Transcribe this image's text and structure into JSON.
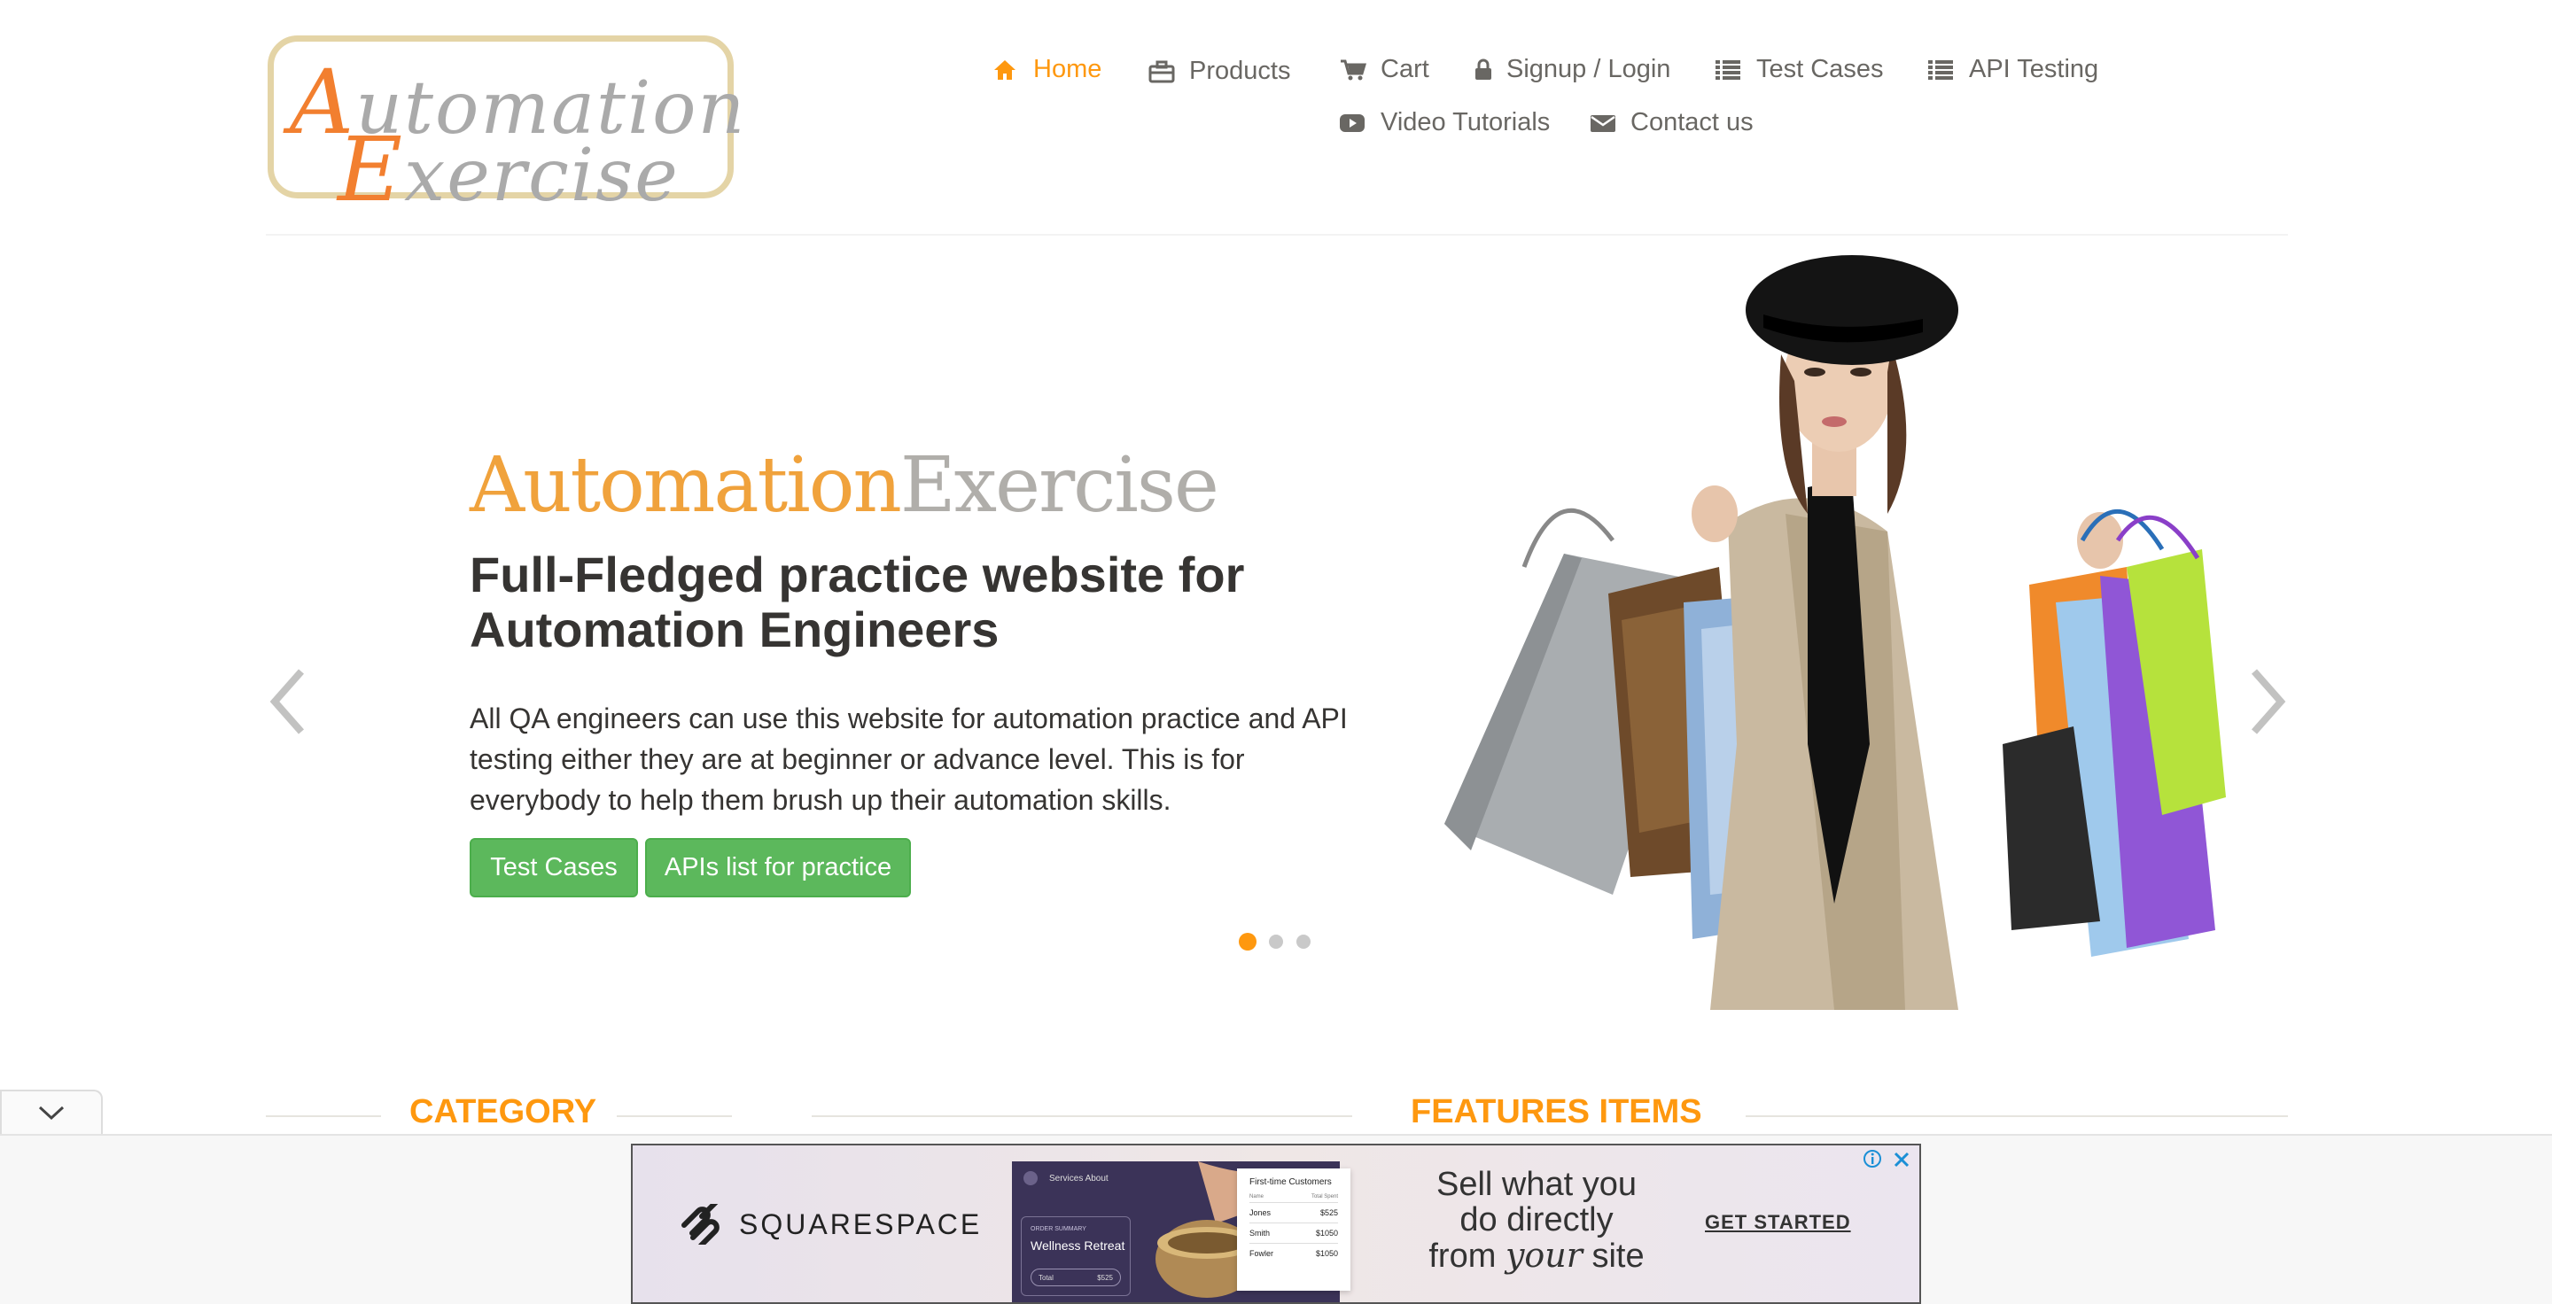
{
  "logo": {
    "line1_cap": "A",
    "line1_rest": "utomation",
    "line2_cap": "E",
    "line2_rest": "xercise"
  },
  "nav": {
    "home": "Home",
    "products": "Products",
    "cart": "Cart",
    "signup": "Signup / Login",
    "test_cases": "Test Cases",
    "api_testing": "API Testing",
    "video_tutorials": "Video Tutorials",
    "contact": "Contact us",
    "active_color": "#fe980f"
  },
  "slider": {
    "title_a": "Automation",
    "title_b": "Exercise",
    "heading": "Full-Fledged practice website for Automation Engineers",
    "text": "All QA engineers can use this website for automation practice and API testing either they are at beginner or advance level. This is for everybody to help them brush up their automation skills.",
    "btn_test_cases": "Test Cases",
    "btn_apis": "APIs list for practice",
    "active_slide": 1,
    "slide_count": 3
  },
  "sections": {
    "category": "CATEGORY",
    "features": "FEATURES ITEMS"
  },
  "ad": {
    "brand": "SQUARESPACE",
    "mock_nav": "Services   About",
    "mock_kicker": "ORDER SUMMARY",
    "mock_title": "Wellness Retreat",
    "mock_total_label": "Total",
    "mock_total": "$525",
    "table_title": "First-time Customers",
    "table_col1": "Name",
    "table_col2": "Total Spent",
    "rows": [
      {
        "name": "Jones",
        "amount": "$525"
      },
      {
        "name": "Smith",
        "amount": "$1050"
      },
      {
        "name": "Fowler",
        "amount": "$1050"
      }
    ],
    "headline_1": "Sell what you",
    "headline_2": "do directly",
    "headline_3a": "from ",
    "headline_3b": "your",
    "headline_3c": " site",
    "cta": "GET STARTED"
  },
  "colors": {
    "accent": "#fe980f",
    "button": "#5cb85c",
    "text": "#696763",
    "heading": "#363432"
  }
}
